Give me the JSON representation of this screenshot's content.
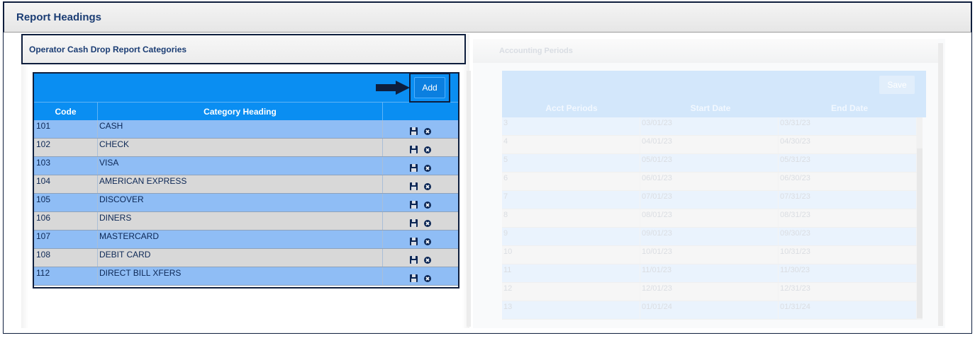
{
  "page": {
    "title": "Report Headings"
  },
  "cash_drop": {
    "title": "Operator Cash Drop Report Categories",
    "add_label": "Add",
    "columns": [
      "Code",
      "Category Heading",
      ""
    ],
    "rows": [
      {
        "code": "101",
        "heading": "CASH"
      },
      {
        "code": "102",
        "heading": "CHECK"
      },
      {
        "code": "103",
        "heading": "VISA"
      },
      {
        "code": "104",
        "heading": "AMERICAN EXPRESS"
      },
      {
        "code": "105",
        "heading": "DISCOVER"
      },
      {
        "code": "106",
        "heading": "DINERS"
      },
      {
        "code": "107",
        "heading": "MASTERCARD"
      },
      {
        "code": "108",
        "heading": "DEBIT CARD"
      },
      {
        "code": "112",
        "heading": "DIRECT BILL XFERS"
      }
    ],
    "row_icons": [
      "save-icon",
      "delete-icon"
    ],
    "arrow_icon": "arrow-right-icon"
  },
  "accounting": {
    "title": "Accounting Periods",
    "save_label": "Save",
    "columns": [
      "Acct Periods",
      "Start Date",
      "End Date"
    ],
    "rows": [
      {
        "period": "3",
        "start": "03/01/23",
        "end": "03/31/23"
      },
      {
        "period": "4",
        "start": "04/01/23",
        "end": "04/30/23"
      },
      {
        "period": "5",
        "start": "05/01/23",
        "end": "05/31/23"
      },
      {
        "period": "6",
        "start": "06/01/23",
        "end": "06/30/23"
      },
      {
        "period": "7",
        "start": "07/01/23",
        "end": "07/31/23"
      },
      {
        "period": "8",
        "start": "08/01/23",
        "end": "08/31/23"
      },
      {
        "period": "9",
        "start": "09/01/23",
        "end": "09/30/23"
      },
      {
        "period": "10",
        "start": "10/01/23",
        "end": "10/31/23"
      },
      {
        "period": "11",
        "start": "11/01/23",
        "end": "11/30/23"
      },
      {
        "period": "12",
        "start": "12/01/23",
        "end": "12/31/23"
      },
      {
        "period": "13",
        "start": "01/01/24",
        "end": "01/31/24"
      }
    ]
  },
  "colors": {
    "grid_blue": "#0a8ef2",
    "row_blue": "#8fbdf5",
    "row_gray": "#d8d8d8",
    "title_navy": "#1b3d74",
    "highlight_border": "#0e1e3d"
  }
}
